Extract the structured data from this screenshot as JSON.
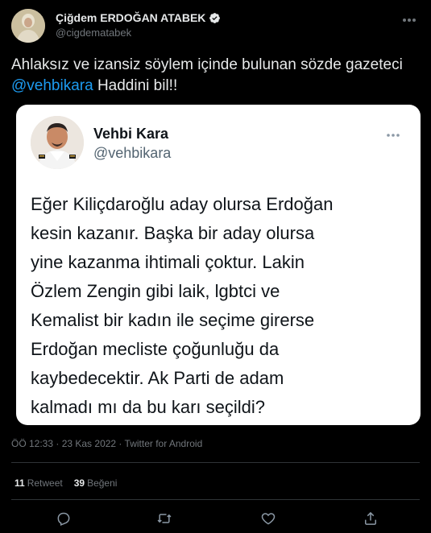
{
  "author": {
    "display_name": "Çiğdem ERDOĞAN ATABEK",
    "handle": "@cigdematabek",
    "verified": true
  },
  "tweet": {
    "text_before": "Ahlaksız ve izansiz söylem içinde bulunan sözde gazeteci ",
    "mention": "@vehbikara",
    "text_after": " Haddini bil!!"
  },
  "quoted": {
    "display_name": "Vehbi Kara",
    "handle": "@vehbikara",
    "text": "Eğer Kiliçdaroğlu aday olursa Erdoğan\nkesin kazanır. Başka bir aday olursa\nyine kazanma ihtimali çoktur. Lakin\nÖzlem Zengin gibi laik, lgbtci  ve\nKemalist bir kadın ile seçime girerse\nErdoğan mecliste çoğunluğu da\nkaybedecektir. Ak Parti de adam\nkalmadı mı da bu karı seçildi?"
  },
  "meta": {
    "timestamp": "ÖÖ 12:33 · 23 Kas 2022 · Twitter for Android"
  },
  "stats": {
    "retweets_count": "11",
    "retweets_label": "Retweet",
    "likes_count": "39",
    "likes_label": "Beğeni"
  },
  "icons": {
    "more": "more-horizontal-icon",
    "reply": "reply-icon",
    "retweet": "retweet-icon",
    "like": "heart-icon",
    "share": "share-icon",
    "verified": "verified-badge-icon"
  },
  "colors": {
    "background": "#000000",
    "mention": "#1d9bf0",
    "secondary_text": "#71767b",
    "card_background": "#ffffff"
  }
}
